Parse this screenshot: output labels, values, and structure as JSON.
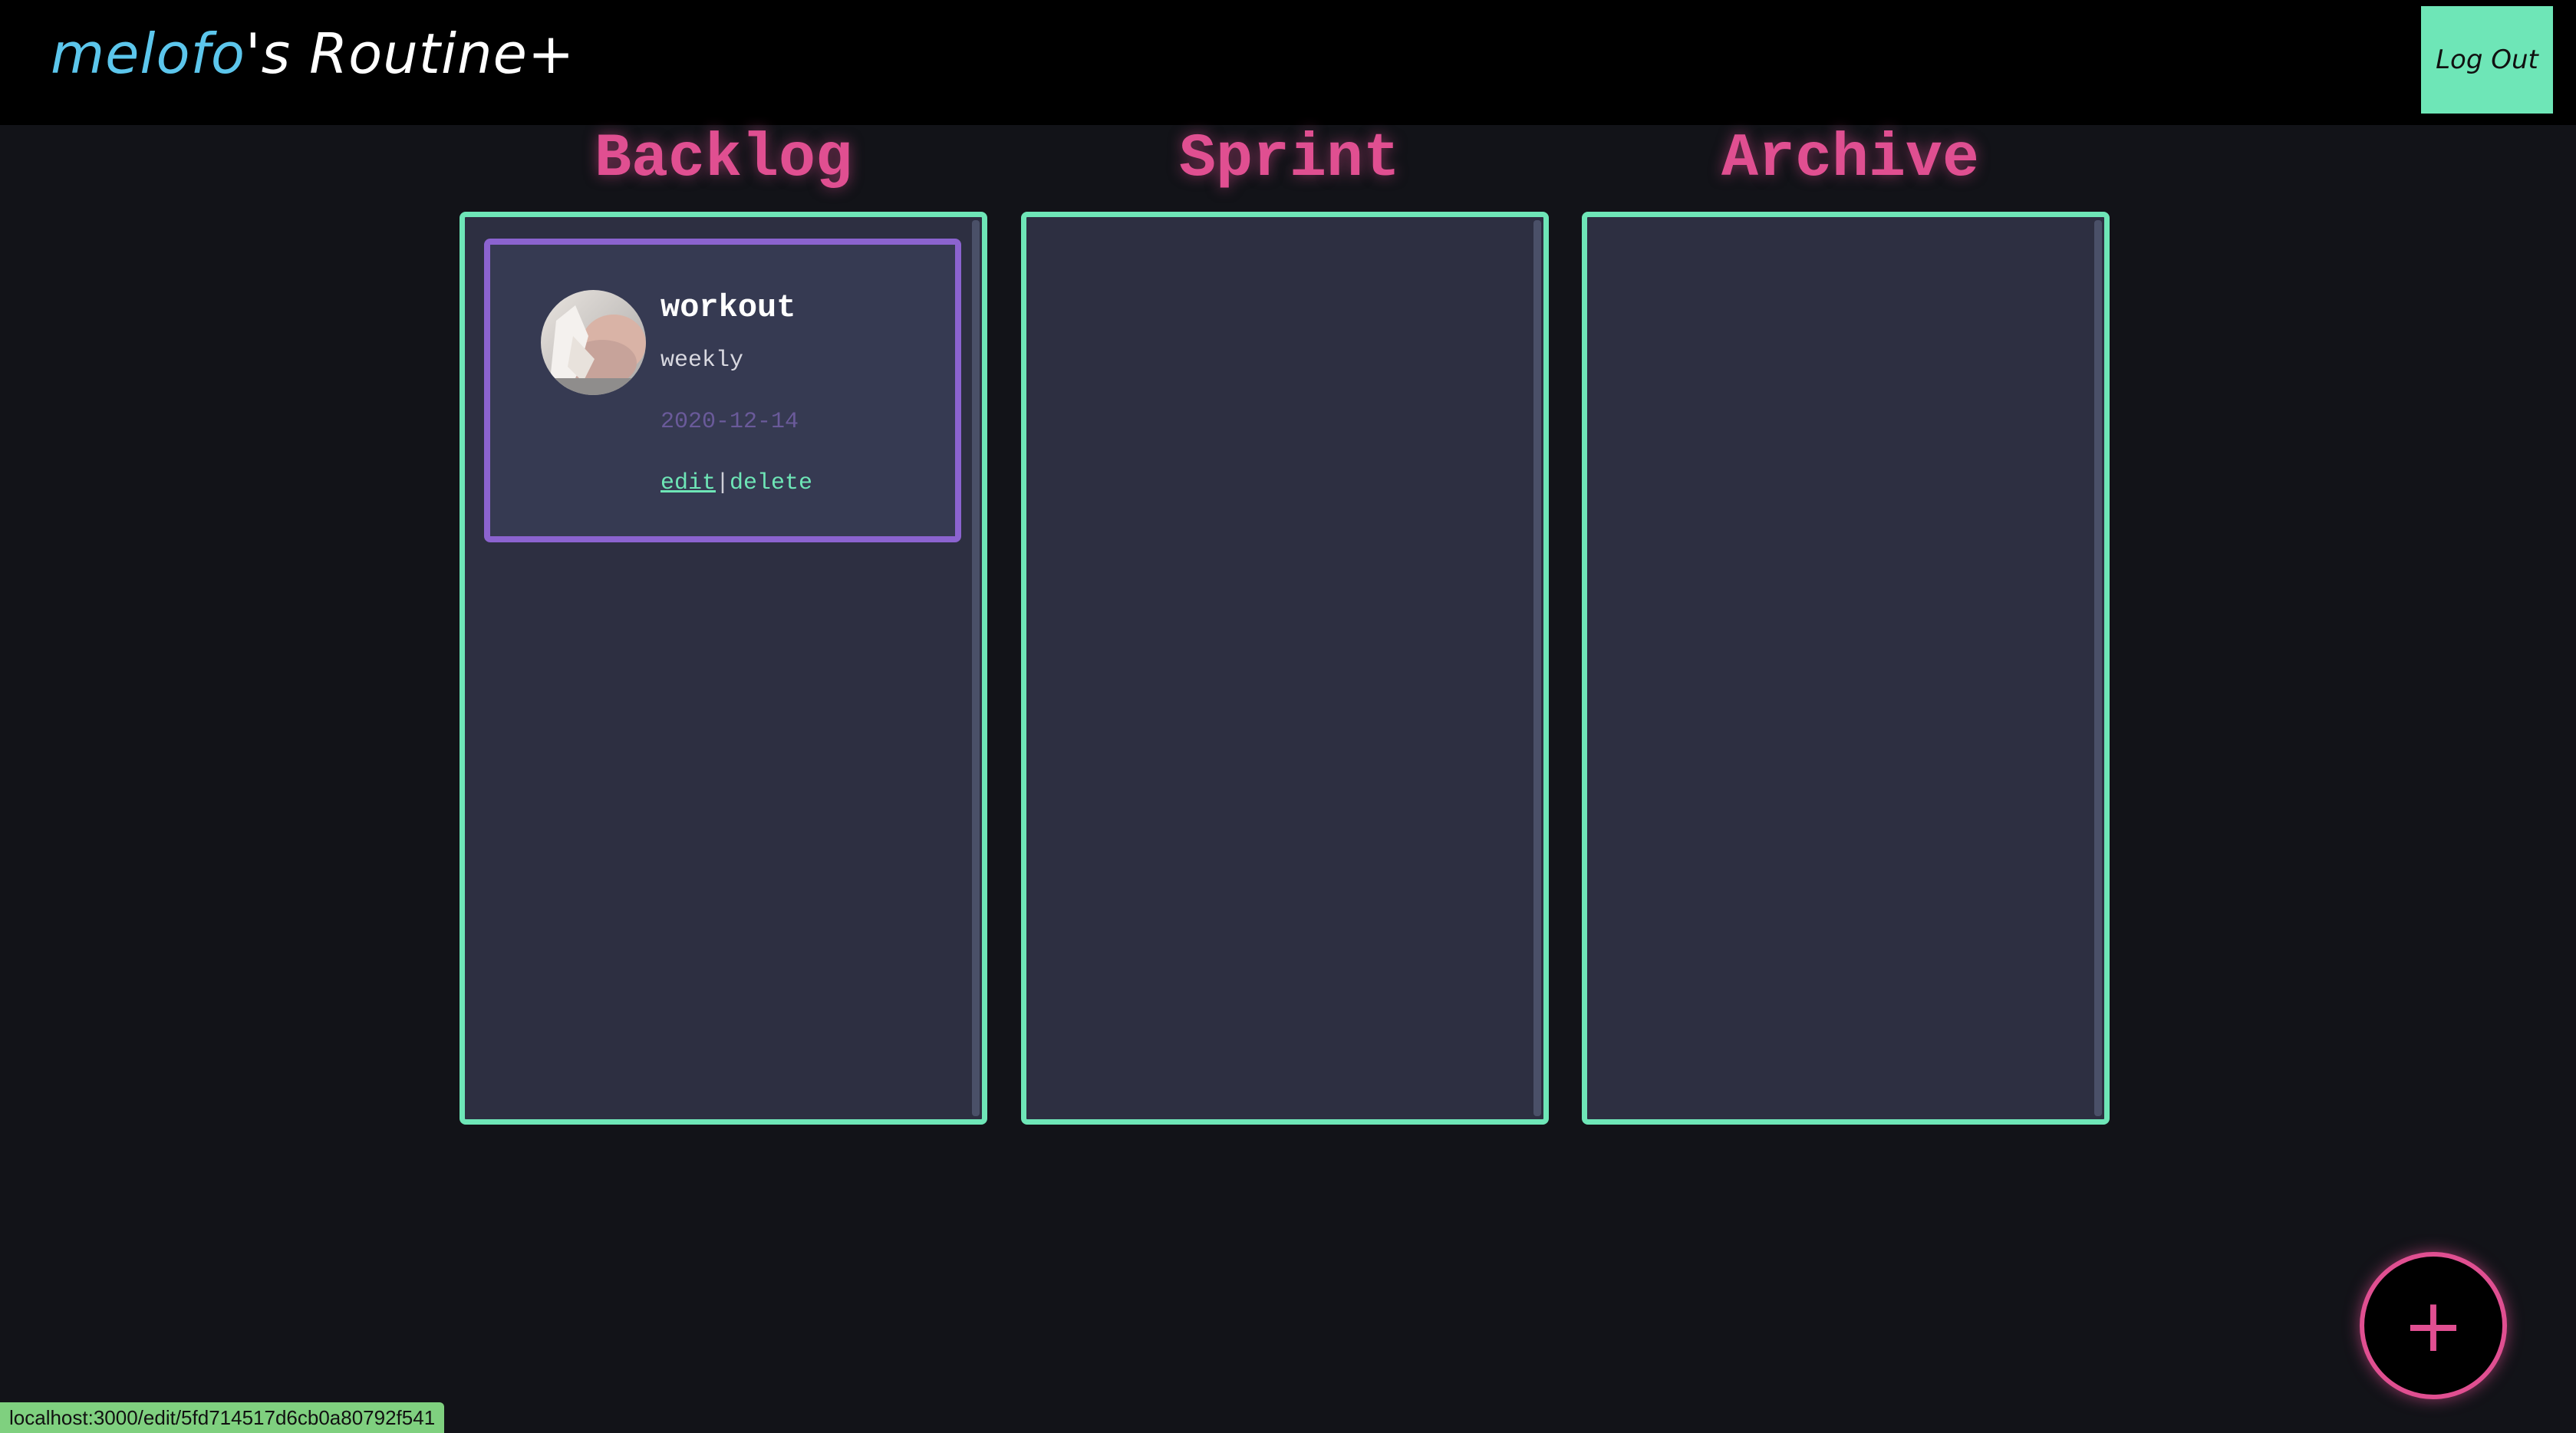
{
  "header": {
    "username": "melofo",
    "title_suffix": "'s Routine+",
    "logout_label": "Log Out"
  },
  "colors": {
    "accent_green": "#6ee6b7",
    "accent_pink": "#e04f91",
    "accent_blue": "#5cc6ec",
    "card_border": "#8b63cf",
    "background": "#121318",
    "column_bg": "#2d2f41"
  },
  "columns": [
    {
      "title": "Backlog"
    },
    {
      "title": "Sprint"
    },
    {
      "title": "Archive"
    }
  ],
  "backlog": {
    "task": {
      "title": "workout",
      "frequency": "weekly",
      "date": "2020-12-14",
      "edit_label": "edit",
      "separator": "|",
      "delete_label": "delete",
      "avatar_icon": "workout-photo"
    }
  },
  "fab": {
    "label": "+",
    "icon": "plus-icon"
  },
  "status_bar": {
    "url": "localhost:3000/edit/5fd714517d6cb0a80792f541"
  }
}
